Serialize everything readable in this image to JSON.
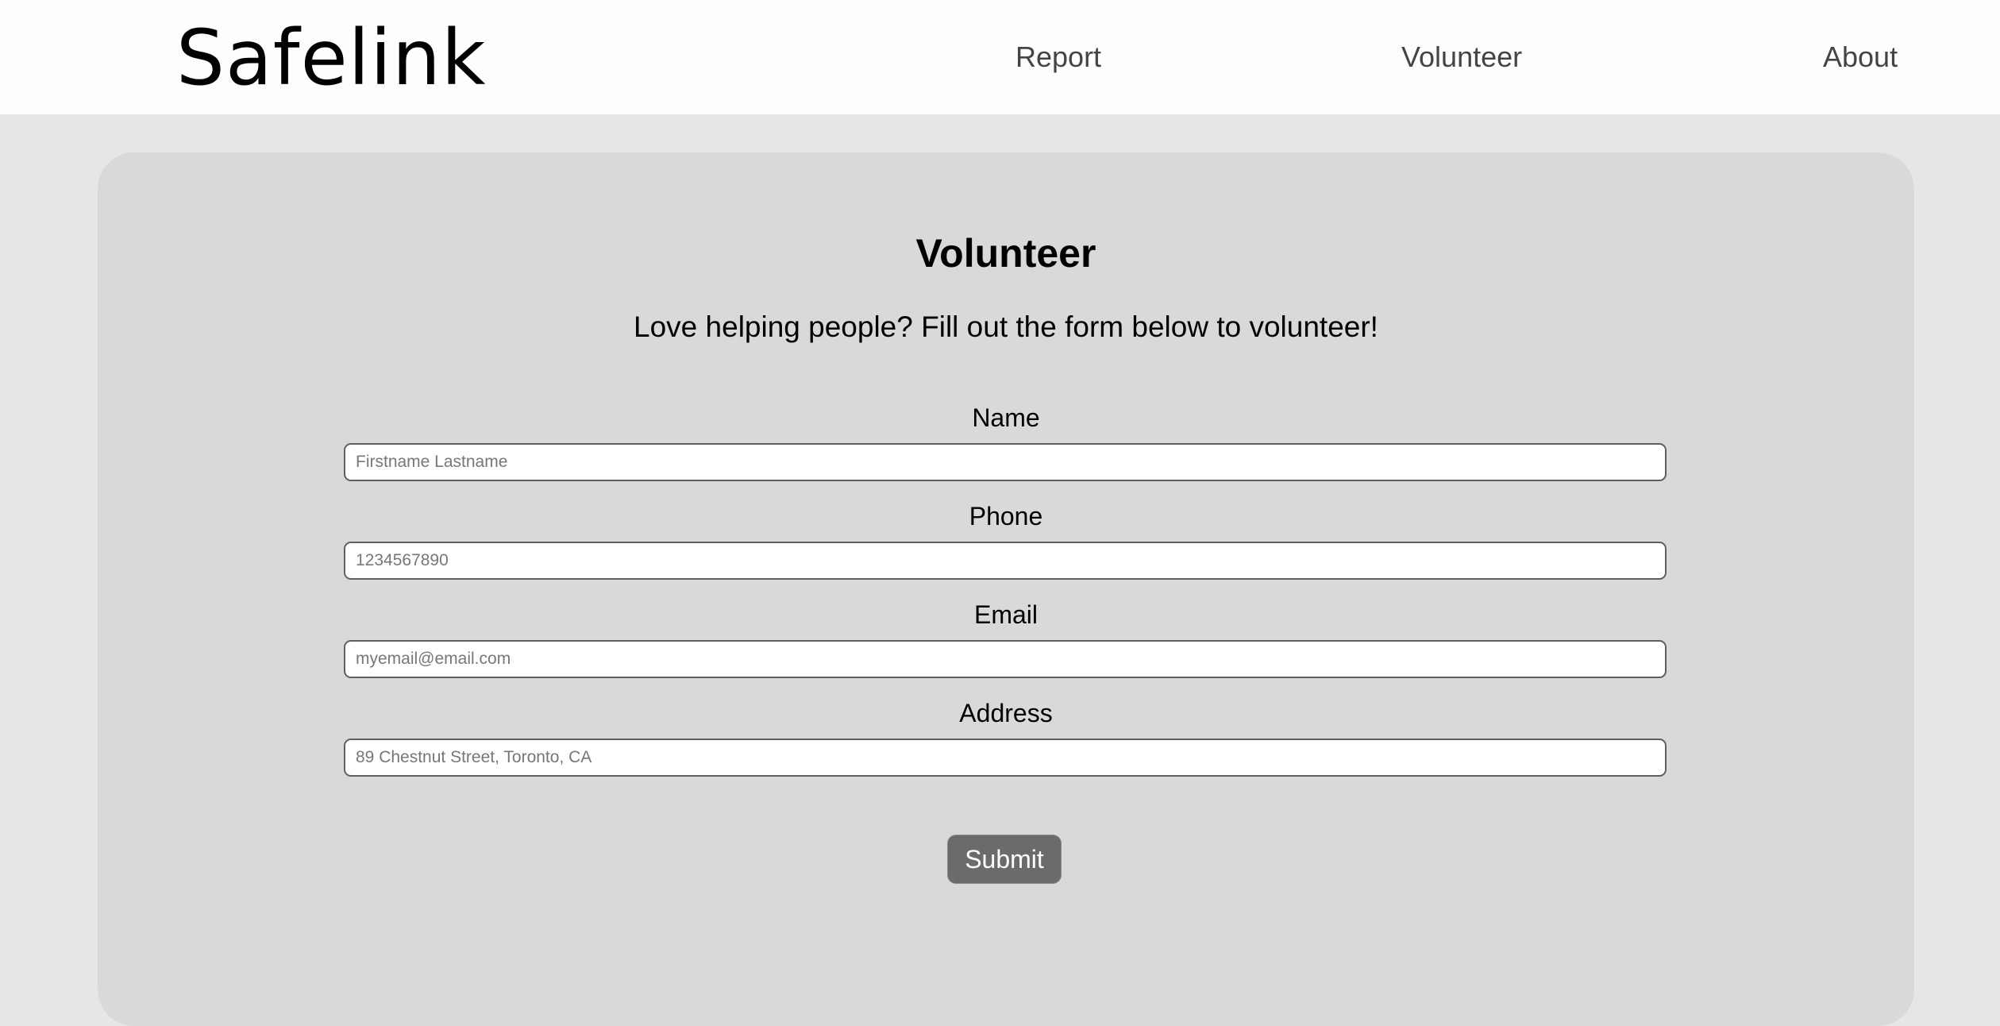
{
  "header": {
    "logo": "Safelink",
    "nav": [
      {
        "label": "Report"
      },
      {
        "label": "Volunteer"
      },
      {
        "label": "About"
      }
    ]
  },
  "main": {
    "title": "Volunteer",
    "subtitle": "Love helping people? Fill out the form below to volunteer!",
    "form": {
      "fields": [
        {
          "label": "Name",
          "placeholder": "Firstname Lastname",
          "value": ""
        },
        {
          "label": "Phone",
          "placeholder": "1234567890",
          "value": ""
        },
        {
          "label": "Email",
          "placeholder": "myemail@email.com",
          "value": ""
        },
        {
          "label": "Address",
          "placeholder": "89 Chestnut Street, Toronto, CA",
          "value": ""
        }
      ],
      "submit_label": "Submit"
    }
  },
  "colors": {
    "page_background": "#e6e6e6",
    "header_background": "#fefefe",
    "card_background": "#d9d9d9",
    "button_background": "#6b6b6b"
  }
}
